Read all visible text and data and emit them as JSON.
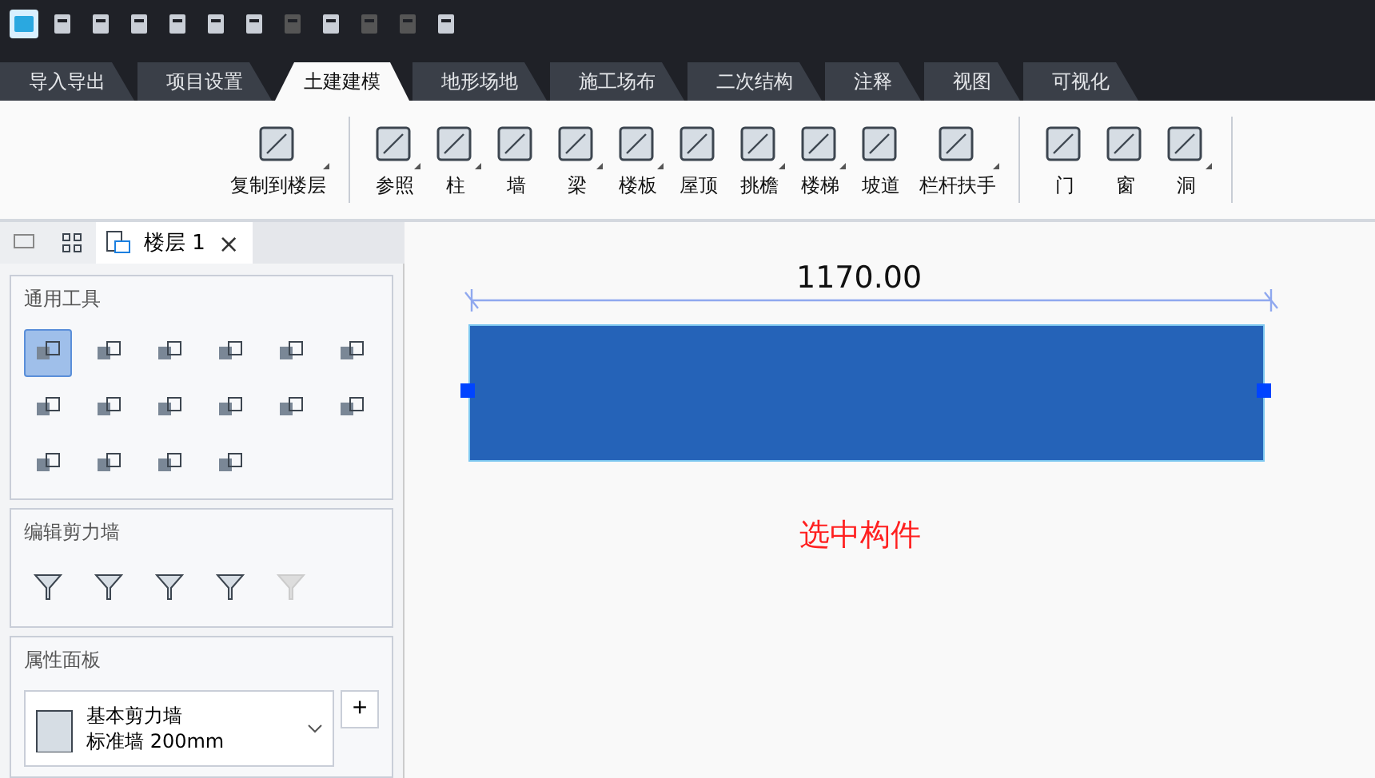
{
  "quick_access": [
    {
      "disabled": false
    },
    {
      "disabled": false
    },
    {
      "disabled": false
    },
    {
      "disabled": false
    },
    {
      "disabled": false
    },
    {
      "disabled": false
    },
    {
      "disabled": true
    },
    {
      "disabled": false
    },
    {
      "disabled": true
    },
    {
      "disabled": true
    },
    {
      "disabled": false
    }
  ],
  "tabs": [
    {
      "label": "导入导出",
      "selected": false
    },
    {
      "label": "项目设置",
      "selected": false
    },
    {
      "label": "土建建模",
      "selected": true
    },
    {
      "label": "地形场地",
      "selected": false
    },
    {
      "label": "施工场布",
      "selected": false
    },
    {
      "label": "二次结构",
      "selected": false
    },
    {
      "label": "注释",
      "selected": false
    },
    {
      "label": "视图",
      "selected": false
    },
    {
      "label": "可视化",
      "selected": false
    }
  ],
  "ribbon": [
    [
      {
        "label": "复制到楼层",
        "dropdown": true
      }
    ],
    [
      {
        "label": "参照",
        "dropdown": true
      },
      {
        "label": "柱",
        "dropdown": true
      },
      {
        "label": "墙",
        "dropdown": false
      },
      {
        "label": "梁",
        "dropdown": true
      },
      {
        "label": "楼板",
        "dropdown": true
      },
      {
        "label": "屋顶",
        "dropdown": false
      },
      {
        "label": "挑檐",
        "dropdown": true
      },
      {
        "label": "楼梯",
        "dropdown": true
      },
      {
        "label": "坡道",
        "dropdown": false
      },
      {
        "label": "栏杆扶手",
        "dropdown": true
      }
    ],
    [
      {
        "label": "门",
        "dropdown": false
      },
      {
        "label": "窗",
        "dropdown": false
      },
      {
        "label": "洞",
        "dropdown": true
      }
    ]
  ],
  "doc_tab": {
    "label": "楼层 1",
    "close": "×"
  },
  "general_tools": {
    "title": "通用工具",
    "tools": [
      {
        "selected": true
      },
      {
        "selected": false
      },
      {
        "selected": false
      },
      {
        "selected": false
      },
      {
        "selected": false
      },
      {
        "selected": false
      },
      {
        "selected": false
      },
      {
        "selected": false
      },
      {
        "selected": false
      },
      {
        "selected": false
      },
      {
        "selected": false
      },
      {
        "selected": false
      },
      {
        "selected": false
      },
      {
        "selected": false
      },
      {
        "selected": false
      },
      {
        "selected": false
      }
    ]
  },
  "edit_wall": {
    "title": "编辑剪力墙",
    "tools": [
      {
        "disabled": false
      },
      {
        "disabled": false
      },
      {
        "disabled": false
      },
      {
        "disabled": false
      },
      {
        "disabled": true
      }
    ]
  },
  "properties": {
    "title": "属性面板",
    "type_name": "基本剪力墙",
    "type_detail": "标准墙 200mm",
    "add": "+"
  },
  "canvas": {
    "dimension": "1170.00",
    "hint": "选中构件"
  }
}
